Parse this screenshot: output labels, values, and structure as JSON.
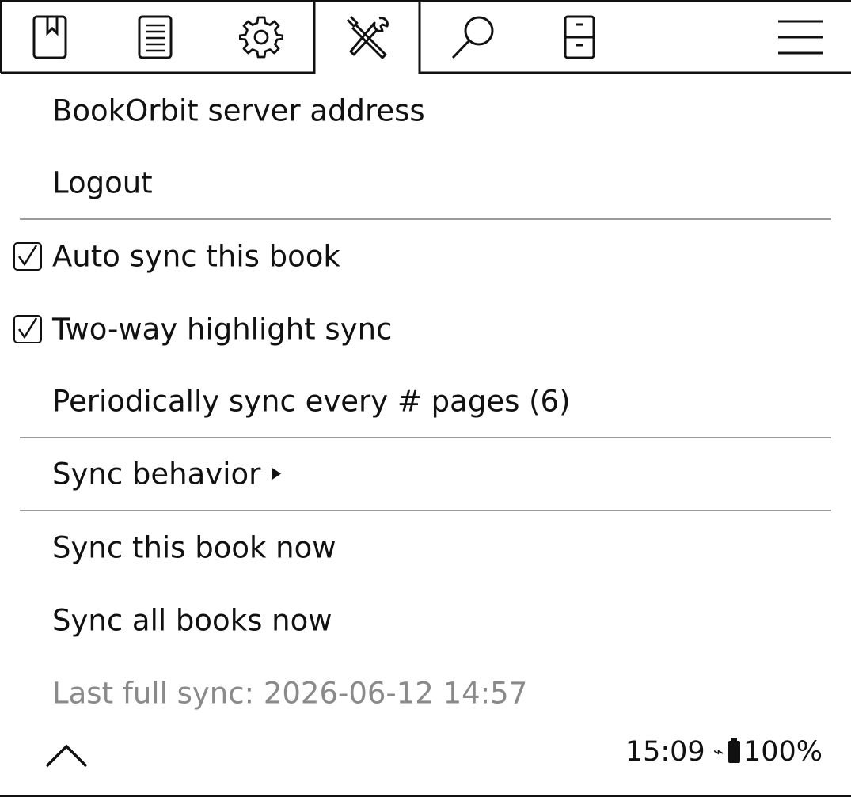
{
  "tabbar": {
    "tabs": [
      {
        "id": "bookmark",
        "icon": "bookmark-icon"
      },
      {
        "id": "toc",
        "icon": "document-list-icon"
      },
      {
        "id": "settings",
        "icon": "gear-icon"
      },
      {
        "id": "tools",
        "icon": "tools-icon",
        "active": true
      },
      {
        "id": "search",
        "icon": "search-icon"
      },
      {
        "id": "filemanager",
        "icon": "file-cabinet-icon"
      },
      {
        "id": "main-menu",
        "icon": "hamburger-icon"
      }
    ]
  },
  "menu": {
    "items": [
      {
        "label": "BookOrbit server address",
        "checked": false
      },
      {
        "label": "Logout",
        "checked": false
      },
      {
        "label": "Auto sync this book",
        "checked": true,
        "check_glyph": "☑"
      },
      {
        "label": "Two-way highlight sync",
        "checked": true,
        "check_glyph": "☑"
      },
      {
        "label": "Periodically sync every # pages (6)",
        "checked": false
      },
      {
        "label": "Sync behavior",
        "submenu": true
      },
      {
        "label": "Sync this book now"
      },
      {
        "label": "Sync all books now"
      },
      {
        "label": "Last full sync: 2026-06-12 14:57",
        "muted": true
      }
    ]
  },
  "status": {
    "time": "15:09",
    "battery": "100%"
  },
  "colors": {
    "text": "#111111",
    "muted": "#8a8a8a",
    "separator": "#9a9a9a"
  }
}
